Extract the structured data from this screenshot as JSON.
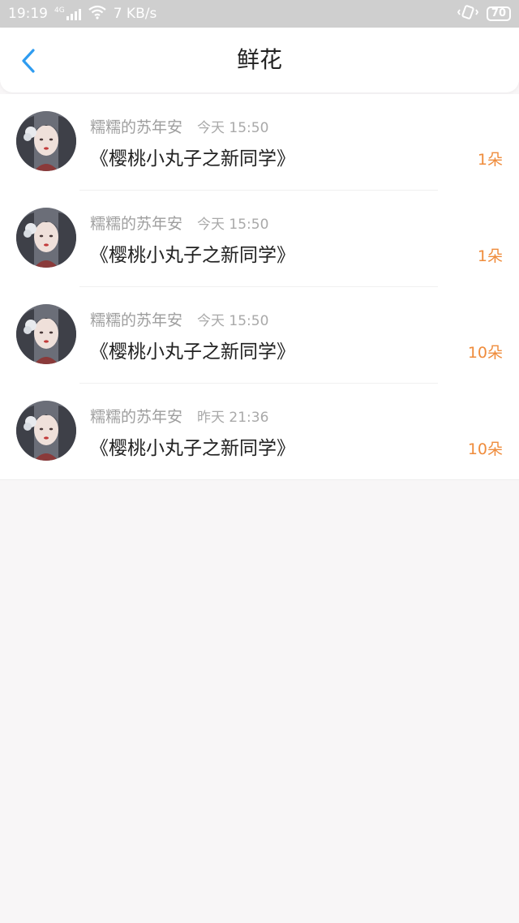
{
  "status_bar": {
    "time": "19:19",
    "network": "4G",
    "speed": "7 KB/s",
    "battery": "70",
    "icons": [
      "signal-icon",
      "wifi-icon",
      "vibrate-icon",
      "battery-icon"
    ]
  },
  "header": {
    "back_icon": "back-arrow-icon",
    "title": "鲜花"
  },
  "colors": {
    "accent": "#2f9cf0",
    "count": "#ef8c3c",
    "status_bar_bg": "#cfcfcf"
  },
  "items": [
    {
      "user": "糯糯的苏年安",
      "time": "今天 15:50",
      "book": "《樱桃小丸子之新同学》",
      "count": "1朵"
    },
    {
      "user": "糯糯的苏年安",
      "time": "今天 15:50",
      "book": "《樱桃小丸子之新同学》",
      "count": "1朵"
    },
    {
      "user": "糯糯的苏年安",
      "time": "今天 15:50",
      "book": "《樱桃小丸子之新同学》",
      "count": "10朵"
    },
    {
      "user": "糯糯的苏年安",
      "time": "昨天 21:36",
      "book": "《樱桃小丸子之新同学》",
      "count": "10朵"
    }
  ]
}
